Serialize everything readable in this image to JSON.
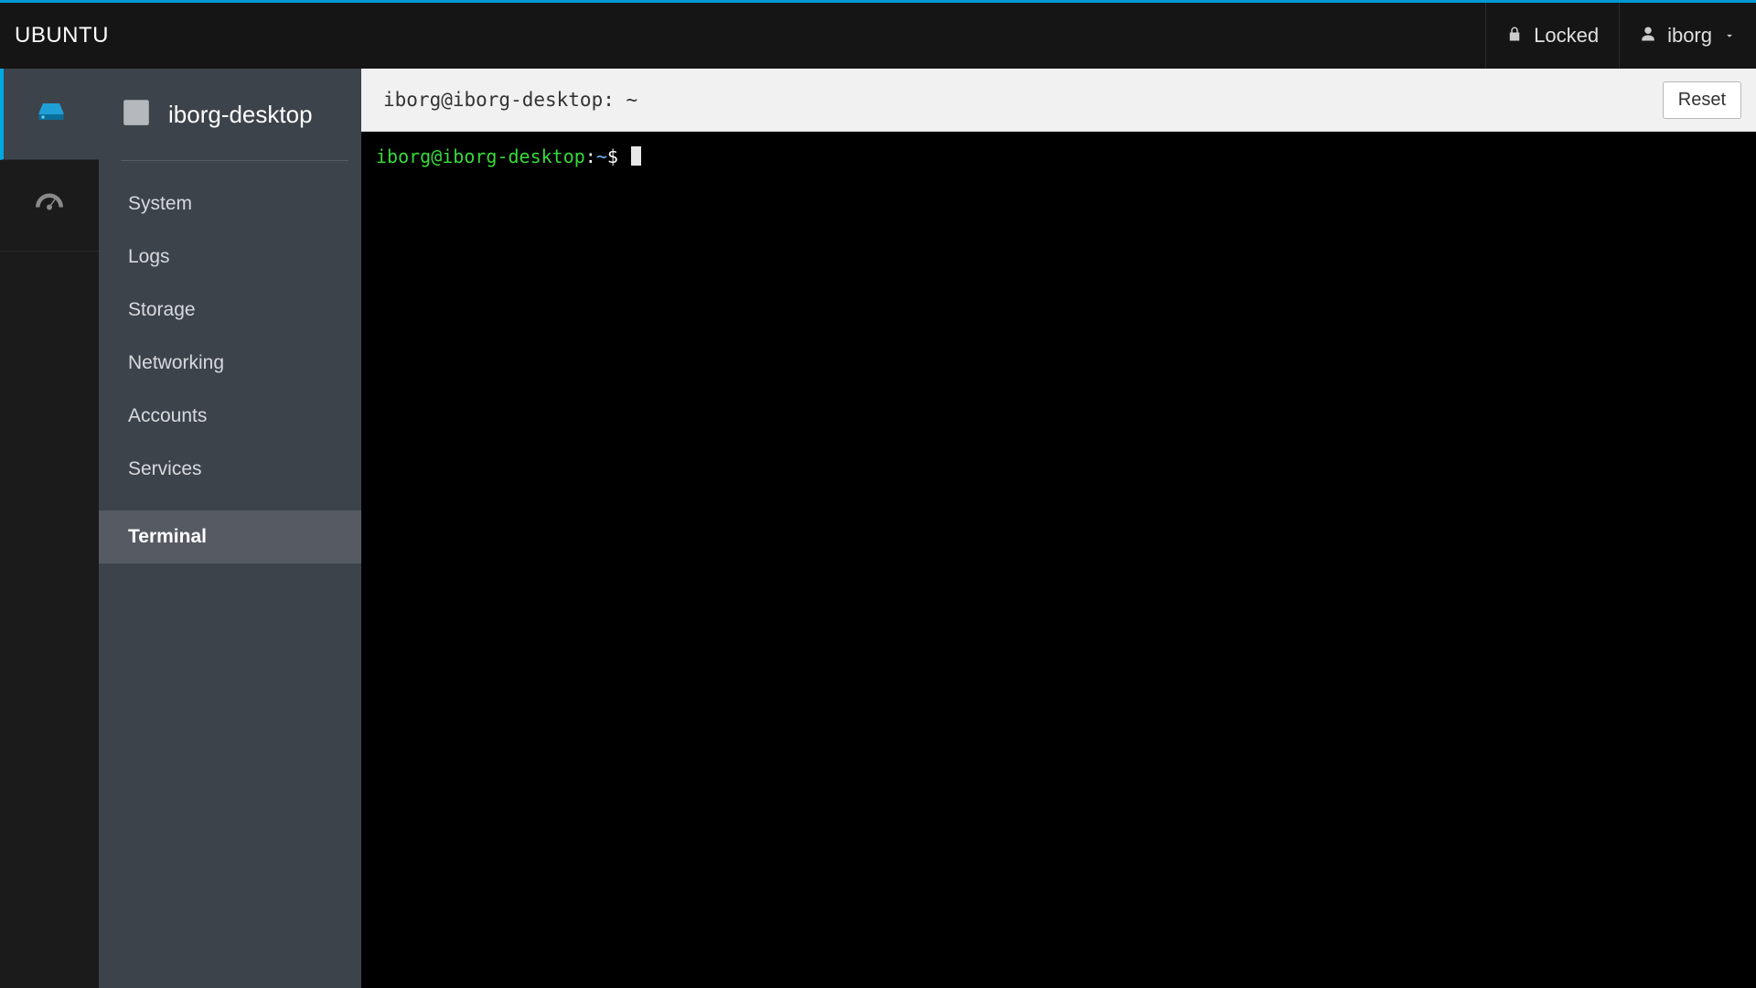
{
  "header": {
    "brand": "UBUNTU",
    "locked_label": "Locked",
    "user": "iborg"
  },
  "rail": {
    "items": [
      {
        "id": "host",
        "active": true
      },
      {
        "id": "dashboard",
        "active": false
      }
    ]
  },
  "sidebar": {
    "hostname": "iborg-desktop",
    "items": [
      {
        "label": "System",
        "active": false
      },
      {
        "label": "Logs",
        "active": false
      },
      {
        "label": "Storage",
        "active": false
      },
      {
        "label": "Networking",
        "active": false
      },
      {
        "label": "Accounts",
        "active": false
      },
      {
        "label": "Services",
        "active": false
      }
    ],
    "items_after_sep": [
      {
        "label": "Terminal",
        "active": true
      }
    ]
  },
  "toolbar": {
    "title": "iborg@iborg-desktop: ~",
    "reset_label": "Reset"
  },
  "terminal": {
    "prompt_userhost": "iborg@iborg-desktop",
    "prompt_sep": ":",
    "prompt_path": "~",
    "prompt_symbol": "$"
  }
}
